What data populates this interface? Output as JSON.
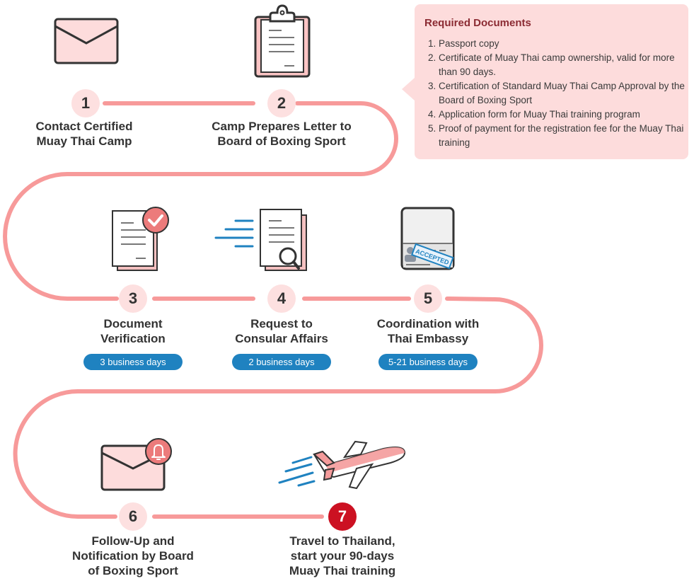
{
  "colors": {
    "path": "#f79a9a",
    "circle_fill": "#fde0e0",
    "final_circle": "#cc1122",
    "badge": "#1f82c0",
    "callout_bg": "#fddcdc",
    "callout_title": "#8b2b33"
  },
  "required_documents": {
    "title": "Required Documents",
    "items": [
      "Passport copy",
      "Certificate of Muay Thai camp ownership, valid for more than 90 days.",
      "Certification of Standard Muay Thai Camp Approval by the Board of Boxing Sport",
      "Application form for Muay Thai training program",
      "Proof of payment for the registration fee for the Muay Thai training"
    ]
  },
  "steps": [
    {
      "number": "1",
      "title_lines": [
        "Contact Certified",
        "Muay Thai Camp"
      ],
      "icon": "envelope-icon"
    },
    {
      "number": "2",
      "title_lines": [
        "Camp Prepares Letter to",
        "Board of Boxing Sport"
      ],
      "icon": "clipboard-icon"
    },
    {
      "number": "3",
      "title_lines": [
        "Document",
        "Verification"
      ],
      "icon": "document-check-icon",
      "duration": "3 business days"
    },
    {
      "number": "4",
      "title_lines": [
        "Request to",
        "Consular Affairs"
      ],
      "icon": "document-search-icon",
      "duration": "2 business days"
    },
    {
      "number": "5",
      "title_lines": [
        "Coordination with",
        "Thai Embassy"
      ],
      "icon": "accepted-passport-icon",
      "duration": "5-21 business days"
    },
    {
      "number": "6",
      "title_lines": [
        "Follow-Up and",
        "Notification by Board",
        "of Boxing Sport"
      ],
      "icon": "envelope-bell-icon"
    },
    {
      "number": "7",
      "title_lines": [
        "Travel to Thailand,",
        "start your 90-days",
        "Muay Thai training"
      ],
      "icon": "airplane-icon"
    }
  ],
  "stamp_text": "ACCEPTED"
}
